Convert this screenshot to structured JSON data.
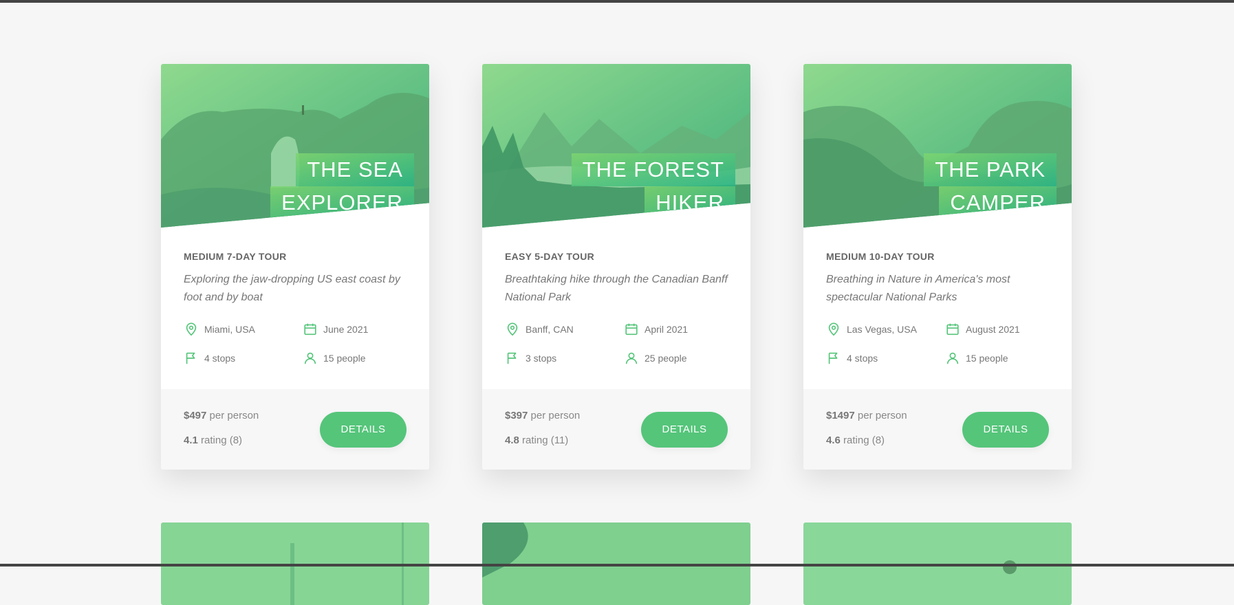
{
  "colors": {
    "accent": "#55c57a",
    "gradient_light": "#7ed56f",
    "gradient_dark": "#28b485",
    "background": "#f6f6f6"
  },
  "icons": {
    "location": "map-pin-icon",
    "date": "calendar-icon",
    "stops": "flag-icon",
    "people": "user-icon"
  },
  "cards": [
    {
      "heading_line1": "THE SEA",
      "heading_line2": "EXPLORER",
      "subheading": "MEDIUM 7-DAY TOUR",
      "description": "Exploring the jaw-dropping US east coast by foot and by boat",
      "location": "Miami, USA",
      "date": "June 2021",
      "stops": "4 stops",
      "people": "15 people",
      "price": "$497",
      "price_suffix": "per person",
      "rating": "4.1",
      "rating_suffix": "rating (8)",
      "button": "DETAILS"
    },
    {
      "heading_line1": "THE FOREST",
      "heading_line2": "HIKER",
      "subheading": "EASY 5-DAY TOUR",
      "description": "Breathtaking hike through the Canadian Banff National Park",
      "location": "Banff, CAN",
      "date": "April 2021",
      "stops": "3 stops",
      "people": "25 people",
      "price": "$397",
      "price_suffix": "per person",
      "rating": "4.8",
      "rating_suffix": "rating (11)",
      "button": "DETAILS"
    },
    {
      "heading_line1": "THE PARK",
      "heading_line2": "CAMPER",
      "subheading": "MEDIUM 10-DAY TOUR",
      "description": "Breathing in Nature in America's most spectacular National Parks",
      "location": "Las Vegas, USA",
      "date": "August 2021",
      "stops": "4 stops",
      "people": "15 people",
      "price": "$1497",
      "price_suffix": "per person",
      "rating": "4.6",
      "rating_suffix": "rating (8)",
      "button": "DETAILS"
    }
  ]
}
